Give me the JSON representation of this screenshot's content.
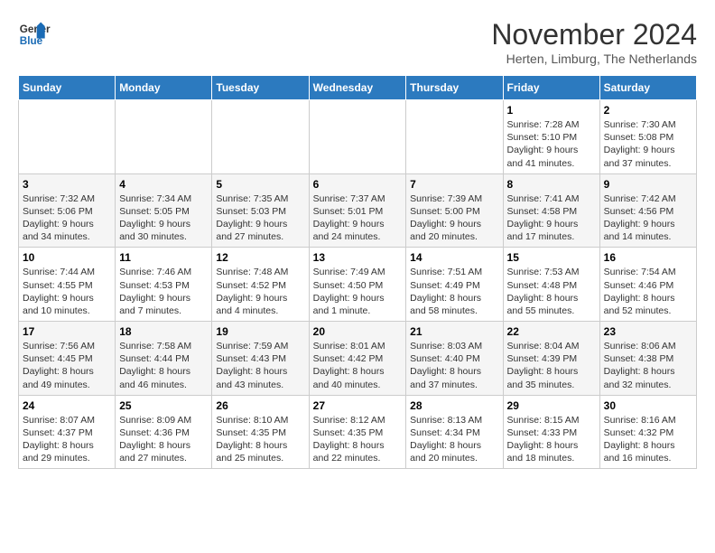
{
  "header": {
    "logo_line1": "General",
    "logo_line2": "Blue",
    "month": "November 2024",
    "location": "Herten, Limburg, The Netherlands"
  },
  "weekdays": [
    "Sunday",
    "Monday",
    "Tuesday",
    "Wednesday",
    "Thursday",
    "Friday",
    "Saturday"
  ],
  "weeks": [
    [
      {
        "day": "",
        "info": ""
      },
      {
        "day": "",
        "info": ""
      },
      {
        "day": "",
        "info": ""
      },
      {
        "day": "",
        "info": ""
      },
      {
        "day": "",
        "info": ""
      },
      {
        "day": "1",
        "info": "Sunrise: 7:28 AM\nSunset: 5:10 PM\nDaylight: 9 hours and 41 minutes."
      },
      {
        "day": "2",
        "info": "Sunrise: 7:30 AM\nSunset: 5:08 PM\nDaylight: 9 hours and 37 minutes."
      }
    ],
    [
      {
        "day": "3",
        "info": "Sunrise: 7:32 AM\nSunset: 5:06 PM\nDaylight: 9 hours and 34 minutes."
      },
      {
        "day": "4",
        "info": "Sunrise: 7:34 AM\nSunset: 5:05 PM\nDaylight: 9 hours and 30 minutes."
      },
      {
        "day": "5",
        "info": "Sunrise: 7:35 AM\nSunset: 5:03 PM\nDaylight: 9 hours and 27 minutes."
      },
      {
        "day": "6",
        "info": "Sunrise: 7:37 AM\nSunset: 5:01 PM\nDaylight: 9 hours and 24 minutes."
      },
      {
        "day": "7",
        "info": "Sunrise: 7:39 AM\nSunset: 5:00 PM\nDaylight: 9 hours and 20 minutes."
      },
      {
        "day": "8",
        "info": "Sunrise: 7:41 AM\nSunset: 4:58 PM\nDaylight: 9 hours and 17 minutes."
      },
      {
        "day": "9",
        "info": "Sunrise: 7:42 AM\nSunset: 4:56 PM\nDaylight: 9 hours and 14 minutes."
      }
    ],
    [
      {
        "day": "10",
        "info": "Sunrise: 7:44 AM\nSunset: 4:55 PM\nDaylight: 9 hours and 10 minutes."
      },
      {
        "day": "11",
        "info": "Sunrise: 7:46 AM\nSunset: 4:53 PM\nDaylight: 9 hours and 7 minutes."
      },
      {
        "day": "12",
        "info": "Sunrise: 7:48 AM\nSunset: 4:52 PM\nDaylight: 9 hours and 4 minutes."
      },
      {
        "day": "13",
        "info": "Sunrise: 7:49 AM\nSunset: 4:50 PM\nDaylight: 9 hours and 1 minute."
      },
      {
        "day": "14",
        "info": "Sunrise: 7:51 AM\nSunset: 4:49 PM\nDaylight: 8 hours and 58 minutes."
      },
      {
        "day": "15",
        "info": "Sunrise: 7:53 AM\nSunset: 4:48 PM\nDaylight: 8 hours and 55 minutes."
      },
      {
        "day": "16",
        "info": "Sunrise: 7:54 AM\nSunset: 4:46 PM\nDaylight: 8 hours and 52 minutes."
      }
    ],
    [
      {
        "day": "17",
        "info": "Sunrise: 7:56 AM\nSunset: 4:45 PM\nDaylight: 8 hours and 49 minutes."
      },
      {
        "day": "18",
        "info": "Sunrise: 7:58 AM\nSunset: 4:44 PM\nDaylight: 8 hours and 46 minutes."
      },
      {
        "day": "19",
        "info": "Sunrise: 7:59 AM\nSunset: 4:43 PM\nDaylight: 8 hours and 43 minutes."
      },
      {
        "day": "20",
        "info": "Sunrise: 8:01 AM\nSunset: 4:42 PM\nDaylight: 8 hours and 40 minutes."
      },
      {
        "day": "21",
        "info": "Sunrise: 8:03 AM\nSunset: 4:40 PM\nDaylight: 8 hours and 37 minutes."
      },
      {
        "day": "22",
        "info": "Sunrise: 8:04 AM\nSunset: 4:39 PM\nDaylight: 8 hours and 35 minutes."
      },
      {
        "day": "23",
        "info": "Sunrise: 8:06 AM\nSunset: 4:38 PM\nDaylight: 8 hours and 32 minutes."
      }
    ],
    [
      {
        "day": "24",
        "info": "Sunrise: 8:07 AM\nSunset: 4:37 PM\nDaylight: 8 hours and 29 minutes."
      },
      {
        "day": "25",
        "info": "Sunrise: 8:09 AM\nSunset: 4:36 PM\nDaylight: 8 hours and 27 minutes."
      },
      {
        "day": "26",
        "info": "Sunrise: 8:10 AM\nSunset: 4:35 PM\nDaylight: 8 hours and 25 minutes."
      },
      {
        "day": "27",
        "info": "Sunrise: 8:12 AM\nSunset: 4:35 PM\nDaylight: 8 hours and 22 minutes."
      },
      {
        "day": "28",
        "info": "Sunrise: 8:13 AM\nSunset: 4:34 PM\nDaylight: 8 hours and 20 minutes."
      },
      {
        "day": "29",
        "info": "Sunrise: 8:15 AM\nSunset: 4:33 PM\nDaylight: 8 hours and 18 minutes."
      },
      {
        "day": "30",
        "info": "Sunrise: 8:16 AM\nSunset: 4:32 PM\nDaylight: 8 hours and 16 minutes."
      }
    ]
  ]
}
